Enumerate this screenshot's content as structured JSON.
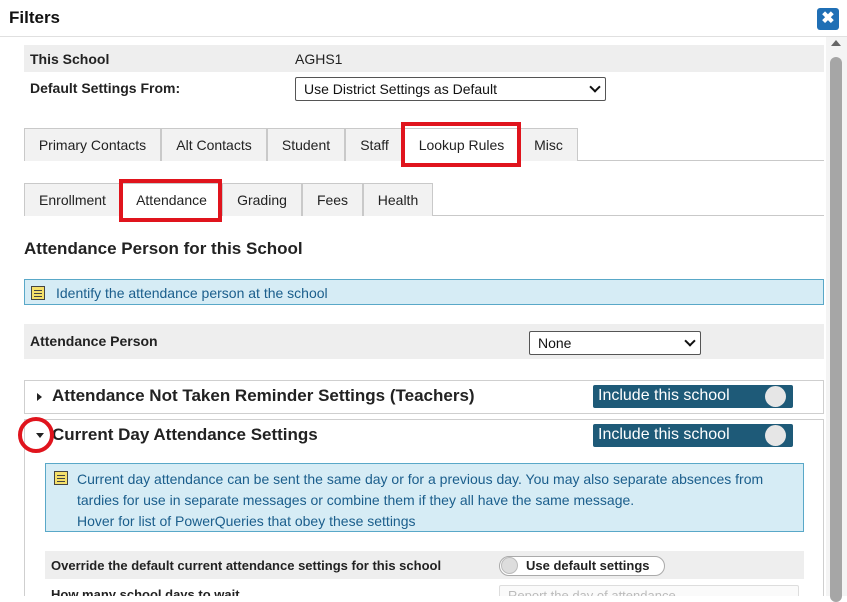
{
  "dialog": {
    "title": "Filters",
    "close_glyph": "✖"
  },
  "school": {
    "label": "This School",
    "value": "AGHS1",
    "default_label": "Default Settings From:",
    "default_value": "Use District Settings as Default"
  },
  "main_tabs": [
    "Primary Contacts",
    "Alt Contacts",
    "Student",
    "Staff",
    "Lookup Rules",
    "Misc"
  ],
  "sub_tabs": [
    "Enrollment",
    "Attendance",
    "Grading",
    "Fees",
    "Health"
  ],
  "attendance_person": {
    "heading": "Attendance Person for this School",
    "info": "Identify the attendance person at the school",
    "label": "Attendance Person",
    "value": "None"
  },
  "not_taken": {
    "title": "Attendance Not Taken Reminder Settings (Teachers)",
    "toggle": "Include this school"
  },
  "current_day": {
    "title": "Current Day Attendance Settings",
    "toggle": "Include this school",
    "info_line1": "Current day attendance can be sent the same day or for a previous day. You may also separate absences from",
    "info_line2": "tardies for use in separate messages or combine them if they all have the same message.",
    "info_line3": "Hover for list of PowerQueries that obey these settings",
    "override_label": "Override the default current attendance settings for this school",
    "override_toggle": "Use default settings",
    "wait_label": "How many school days to wait",
    "wait_value": "Report the day of attendance"
  }
}
